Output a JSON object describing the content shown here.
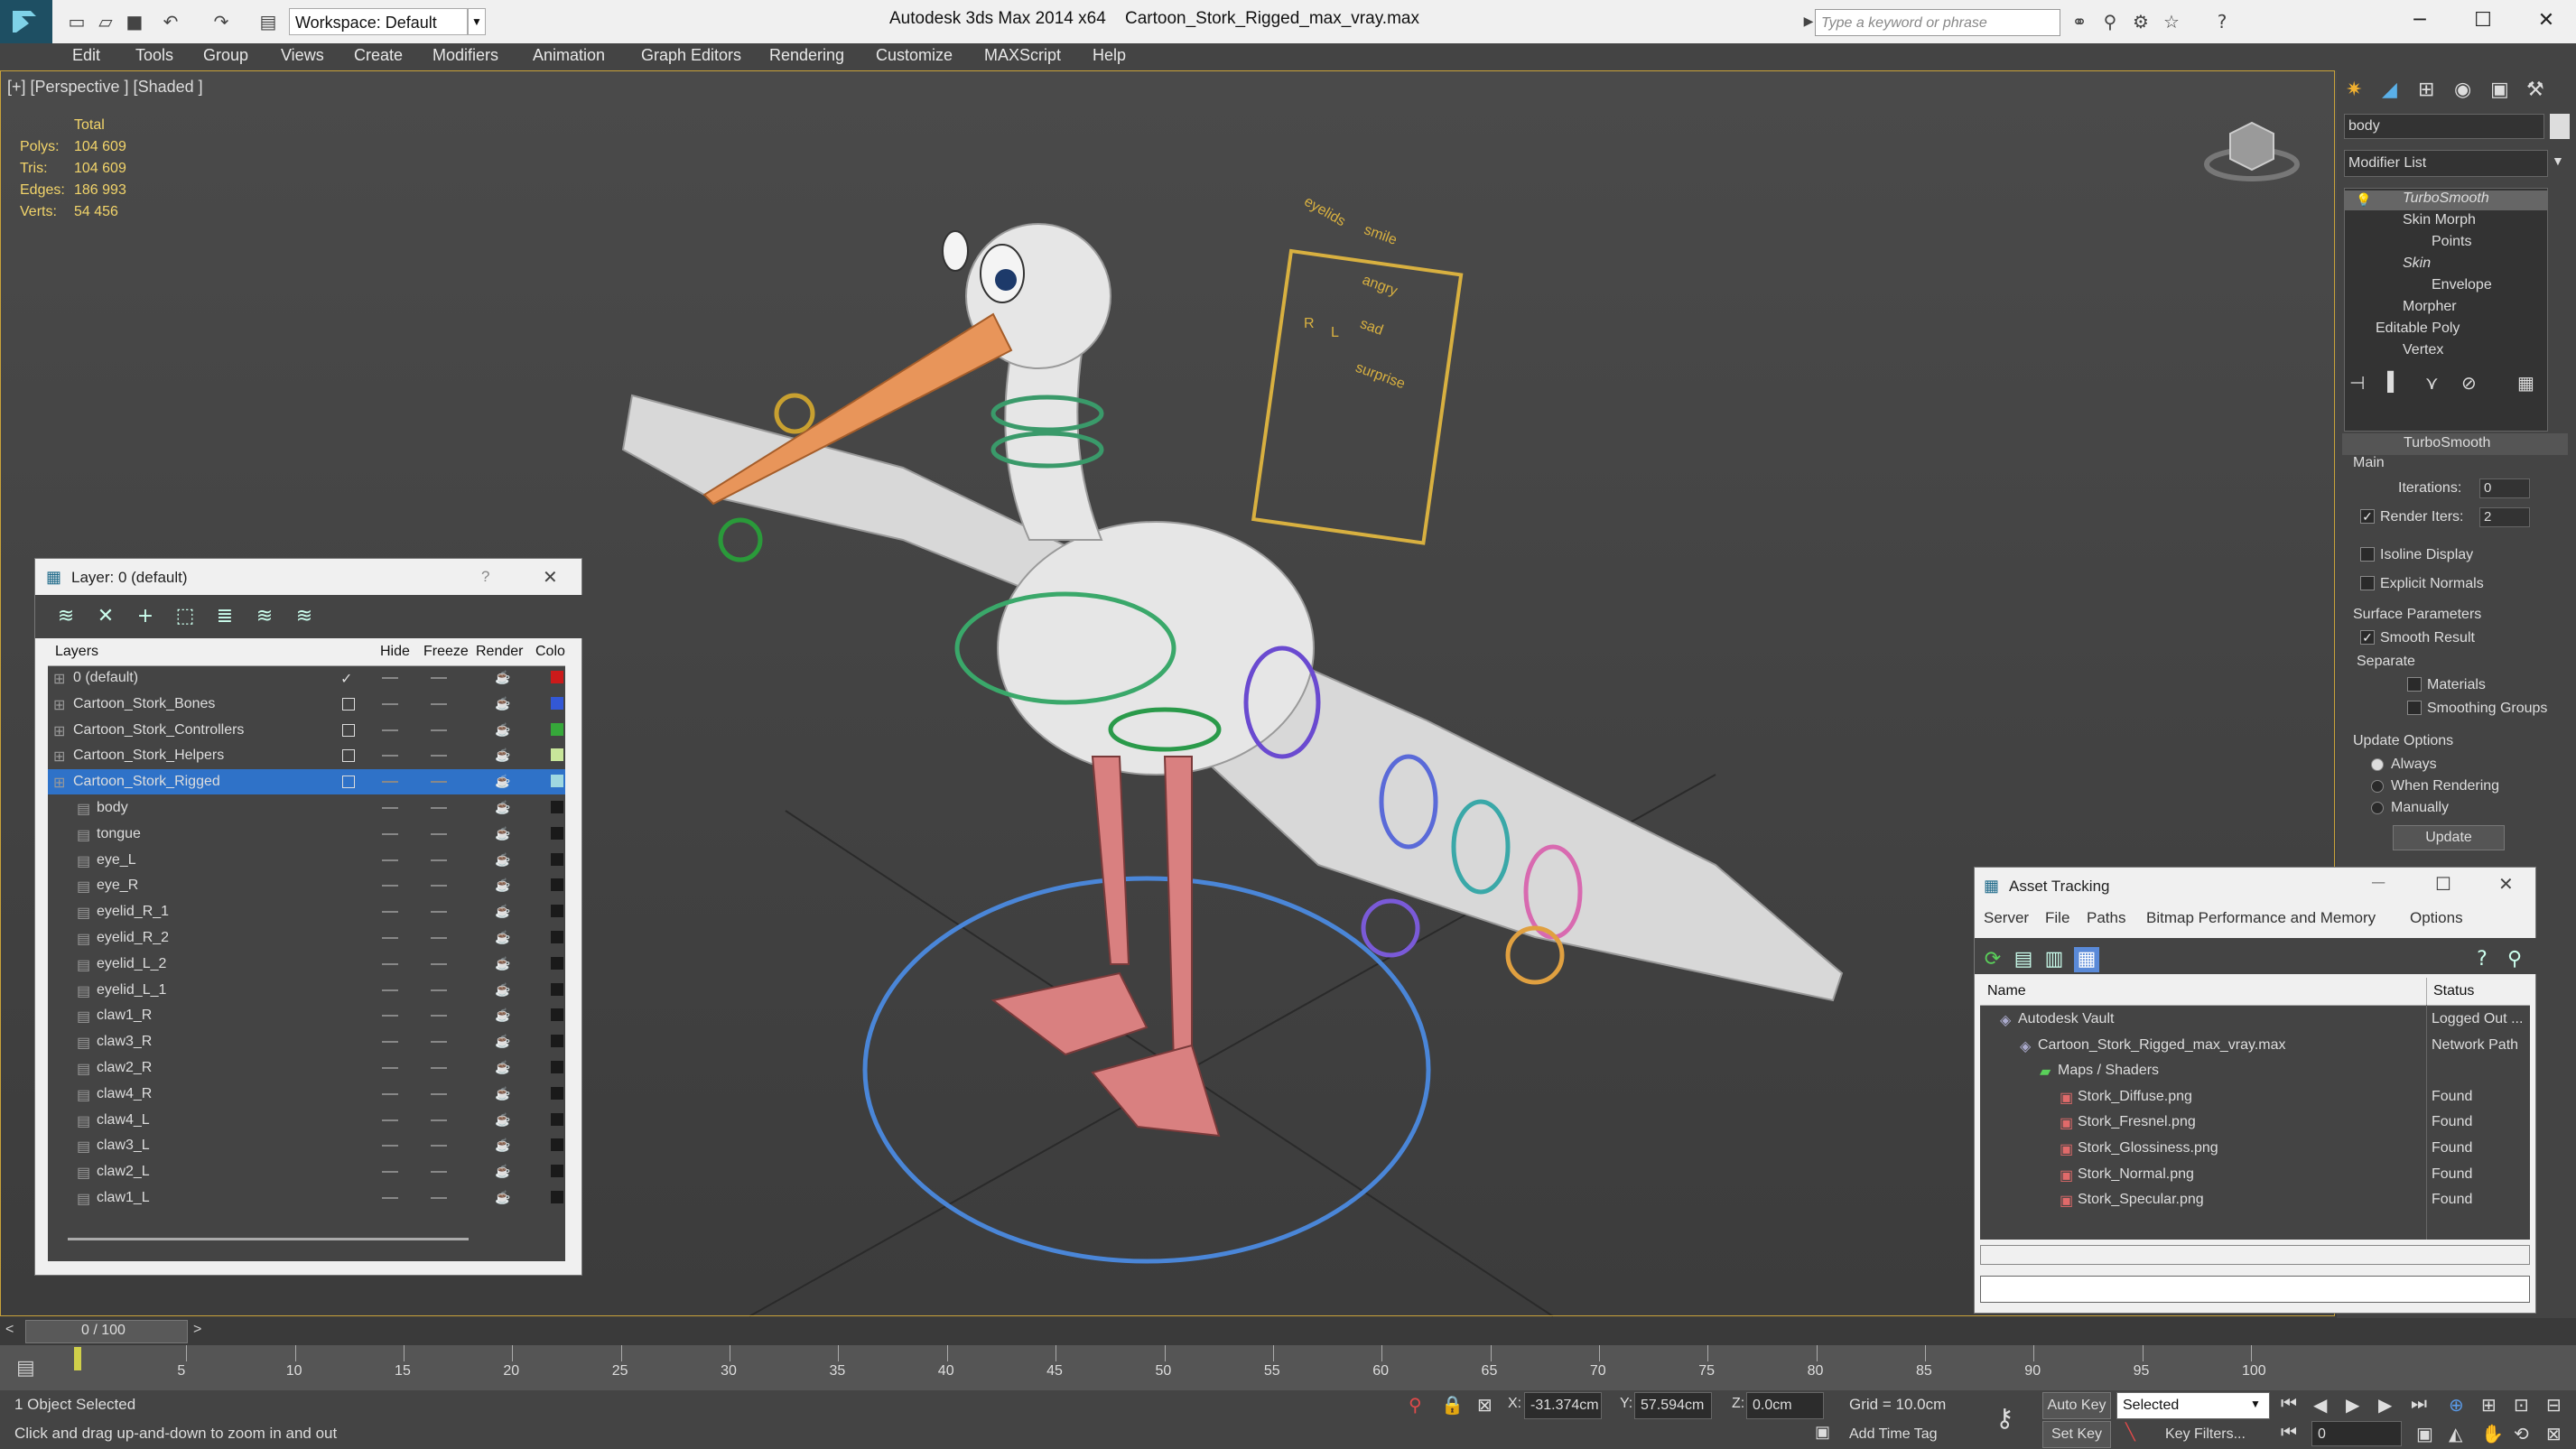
{
  "titlebar": {
    "workspace": "Workspace: Default",
    "app_title": "Autodesk 3ds Max  2014 x64",
    "file_title": "Cartoon_Stork_Rigged_max_vray.max",
    "search_placeholder": "Type a keyword or phrase"
  },
  "menu": [
    "Edit",
    "Tools",
    "Group",
    "Views",
    "Create",
    "Modifiers",
    "Animation",
    "Graph Editors",
    "Rendering",
    "Customize",
    "MAXScript",
    "Help"
  ],
  "viewport": {
    "label": "[+] [Perspective ] [Shaded ]",
    "stats_header": "Total",
    "stats": [
      {
        "label": "Polys:",
        "value": "104 609"
      },
      {
        "label": "Tris:",
        "value": "104 609"
      },
      {
        "label": "Edges:",
        "value": "186 993"
      },
      {
        "label": "Verts:",
        "value": "54 456"
      }
    ],
    "morph_panel": {
      "eyelids": "eyelids",
      "smile": "smile",
      "angry": "angry",
      "sad": "sad",
      "surprise": "surprise",
      "r": "R",
      "l": "L"
    }
  },
  "command_panel": {
    "object_name": "body",
    "modifier_list": "Modifier List",
    "stack": [
      {
        "label": "TurboSmooth",
        "italic": true,
        "indent": 0
      },
      {
        "label": "Skin Morph",
        "italic": false,
        "indent": 0
      },
      {
        "label": "Points",
        "italic": false,
        "indent": 1
      },
      {
        "label": "Skin",
        "italic": true,
        "indent": 0
      },
      {
        "label": "Envelope",
        "italic": false,
        "indent": 1
      },
      {
        "label": "Morpher",
        "italic": false,
        "indent": 0
      },
      {
        "label": "Editable Poly",
        "italic": false,
        "indent": 0
      },
      {
        "label": "Vertex",
        "italic": false,
        "indent": 1
      }
    ],
    "rollout_title": "TurboSmooth",
    "main_label": "Main",
    "iterations_label": "Iterations:",
    "iterations_value": "0",
    "render_iters_label": "Render Iters:",
    "render_iters_value": "2",
    "isoline_label": "Isoline Display",
    "explicit_normals_label": "Explicit Normals",
    "surface_params_label": "Surface Parameters",
    "smooth_result_label": "Smooth Result",
    "separate_label": "Separate",
    "materials_label": "Materials",
    "smoothing_groups_label": "Smoothing Groups",
    "update_options_label": "Update Options",
    "always_label": "Always",
    "when_rendering_label": "When Rendering",
    "manually_label": "Manually",
    "update_button": "Update"
  },
  "layer_dialog": {
    "title": "Layer: 0 (default)",
    "help": "?",
    "columns": {
      "layers": "Layers",
      "hide": "Hide",
      "freeze": "Freeze",
      "render": "Render",
      "color": "Colo"
    },
    "rows": [
      {
        "name": "0 (default)",
        "level": 0,
        "color": "#cc1a1a",
        "current": true,
        "selected": false
      },
      {
        "name": "Cartoon_Stork_Bones",
        "level": 0,
        "color": "#3358d6",
        "current": false,
        "selected": false
      },
      {
        "name": "Cartoon_Stork_Controllers",
        "level": 0,
        "color": "#36a83a",
        "current": false,
        "selected": false
      },
      {
        "name": "Cartoon_Stork_Helpers",
        "level": 0,
        "color": "#c8e69a",
        "current": false,
        "selected": false
      },
      {
        "name": "Cartoon_Stork_Rigged",
        "level": 0,
        "color": "#9fd8e0",
        "current": false,
        "selected": true
      },
      {
        "name": "body",
        "level": 1,
        "color": "#1a1a1a",
        "current": false,
        "selected": false
      },
      {
        "name": "tongue",
        "level": 1,
        "color": "#1a1a1a",
        "current": false,
        "selected": false
      },
      {
        "name": "eye_L",
        "level": 1,
        "color": "#1a1a1a",
        "current": false,
        "selected": false
      },
      {
        "name": "eye_R",
        "level": 1,
        "color": "#1a1a1a",
        "current": false,
        "selected": false
      },
      {
        "name": "eyelid_R_1",
        "level": 1,
        "color": "#1a1a1a",
        "current": false,
        "selected": false
      },
      {
        "name": "eyelid_R_2",
        "level": 1,
        "color": "#1a1a1a",
        "current": false,
        "selected": false
      },
      {
        "name": "eyelid_L_2",
        "level": 1,
        "color": "#1a1a1a",
        "current": false,
        "selected": false
      },
      {
        "name": "eyelid_L_1",
        "level": 1,
        "color": "#1a1a1a",
        "current": false,
        "selected": false
      },
      {
        "name": "claw1_R",
        "level": 1,
        "color": "#1a1a1a",
        "current": false,
        "selected": false
      },
      {
        "name": "claw3_R",
        "level": 1,
        "color": "#1a1a1a",
        "current": false,
        "selected": false
      },
      {
        "name": "claw2_R",
        "level": 1,
        "color": "#1a1a1a",
        "current": false,
        "selected": false
      },
      {
        "name": "claw4_R",
        "level": 1,
        "color": "#1a1a1a",
        "current": false,
        "selected": false
      },
      {
        "name": "claw4_L",
        "level": 1,
        "color": "#1a1a1a",
        "current": false,
        "selected": false
      },
      {
        "name": "claw3_L",
        "level": 1,
        "color": "#1a1a1a",
        "current": false,
        "selected": false
      },
      {
        "name": "claw2_L",
        "level": 1,
        "color": "#1a1a1a",
        "current": false,
        "selected": false
      },
      {
        "name": "claw1_L",
        "level": 1,
        "color": "#1a1a1a",
        "current": false,
        "selected": false
      }
    ]
  },
  "asset_dialog": {
    "title": "Asset Tracking",
    "menu": [
      "Server",
      "File",
      "Paths",
      "Bitmap Performance and Memory",
      "Options"
    ],
    "columns": {
      "name": "Name",
      "status": "Status"
    },
    "rows": [
      {
        "name": "Autodesk Vault",
        "status": "Logged Out ...",
        "level": 1,
        "icon": "vault-icon"
      },
      {
        "name": "Cartoon_Stork_Rigged_max_vray.max",
        "status": "Network Path",
        "level": 2,
        "icon": "max-file-icon"
      },
      {
        "name": "Maps / Shaders",
        "status": "",
        "level": 3,
        "icon": "maps-icon"
      },
      {
        "name": "Stork_Diffuse.png",
        "status": "Found",
        "level": 4,
        "icon": "png-icon"
      },
      {
        "name": "Stork_Fresnel.png",
        "status": "Found",
        "level": 4,
        "icon": "png-icon"
      },
      {
        "name": "Stork_Glossiness.png",
        "status": "Found",
        "level": 4,
        "icon": "png-icon"
      },
      {
        "name": "Stork_Normal.png",
        "status": "Found",
        "level": 4,
        "icon": "png-icon"
      },
      {
        "name": "Stork_Specular.png",
        "status": "Found",
        "level": 4,
        "icon": "png-icon"
      }
    ]
  },
  "timeline": {
    "frame": "0 / 100",
    "ticks": [
      "5",
      "10",
      "15",
      "20",
      "25",
      "30",
      "35",
      "40",
      "45",
      "50",
      "55",
      "60",
      "65",
      "70",
      "75",
      "80",
      "85",
      "90",
      "95",
      "100"
    ]
  },
  "status": {
    "selected": "1 Object Selected",
    "prompt": "Click and drag up-and-down to zoom in and out",
    "x_label": "X:",
    "x_value": "-31.374cm",
    "y_label": "Y:",
    "y_value": "57.594cm",
    "z_label": "Z:",
    "z_value": "0.0cm",
    "grid": "Grid = 10.0cm",
    "add_time_tag": "Add Time Tag",
    "auto_key": "Auto Key",
    "set_key": "Set Key",
    "selected_dropdown": "Selected",
    "key_filters": "Key Filters...",
    "frame_field": "0"
  }
}
